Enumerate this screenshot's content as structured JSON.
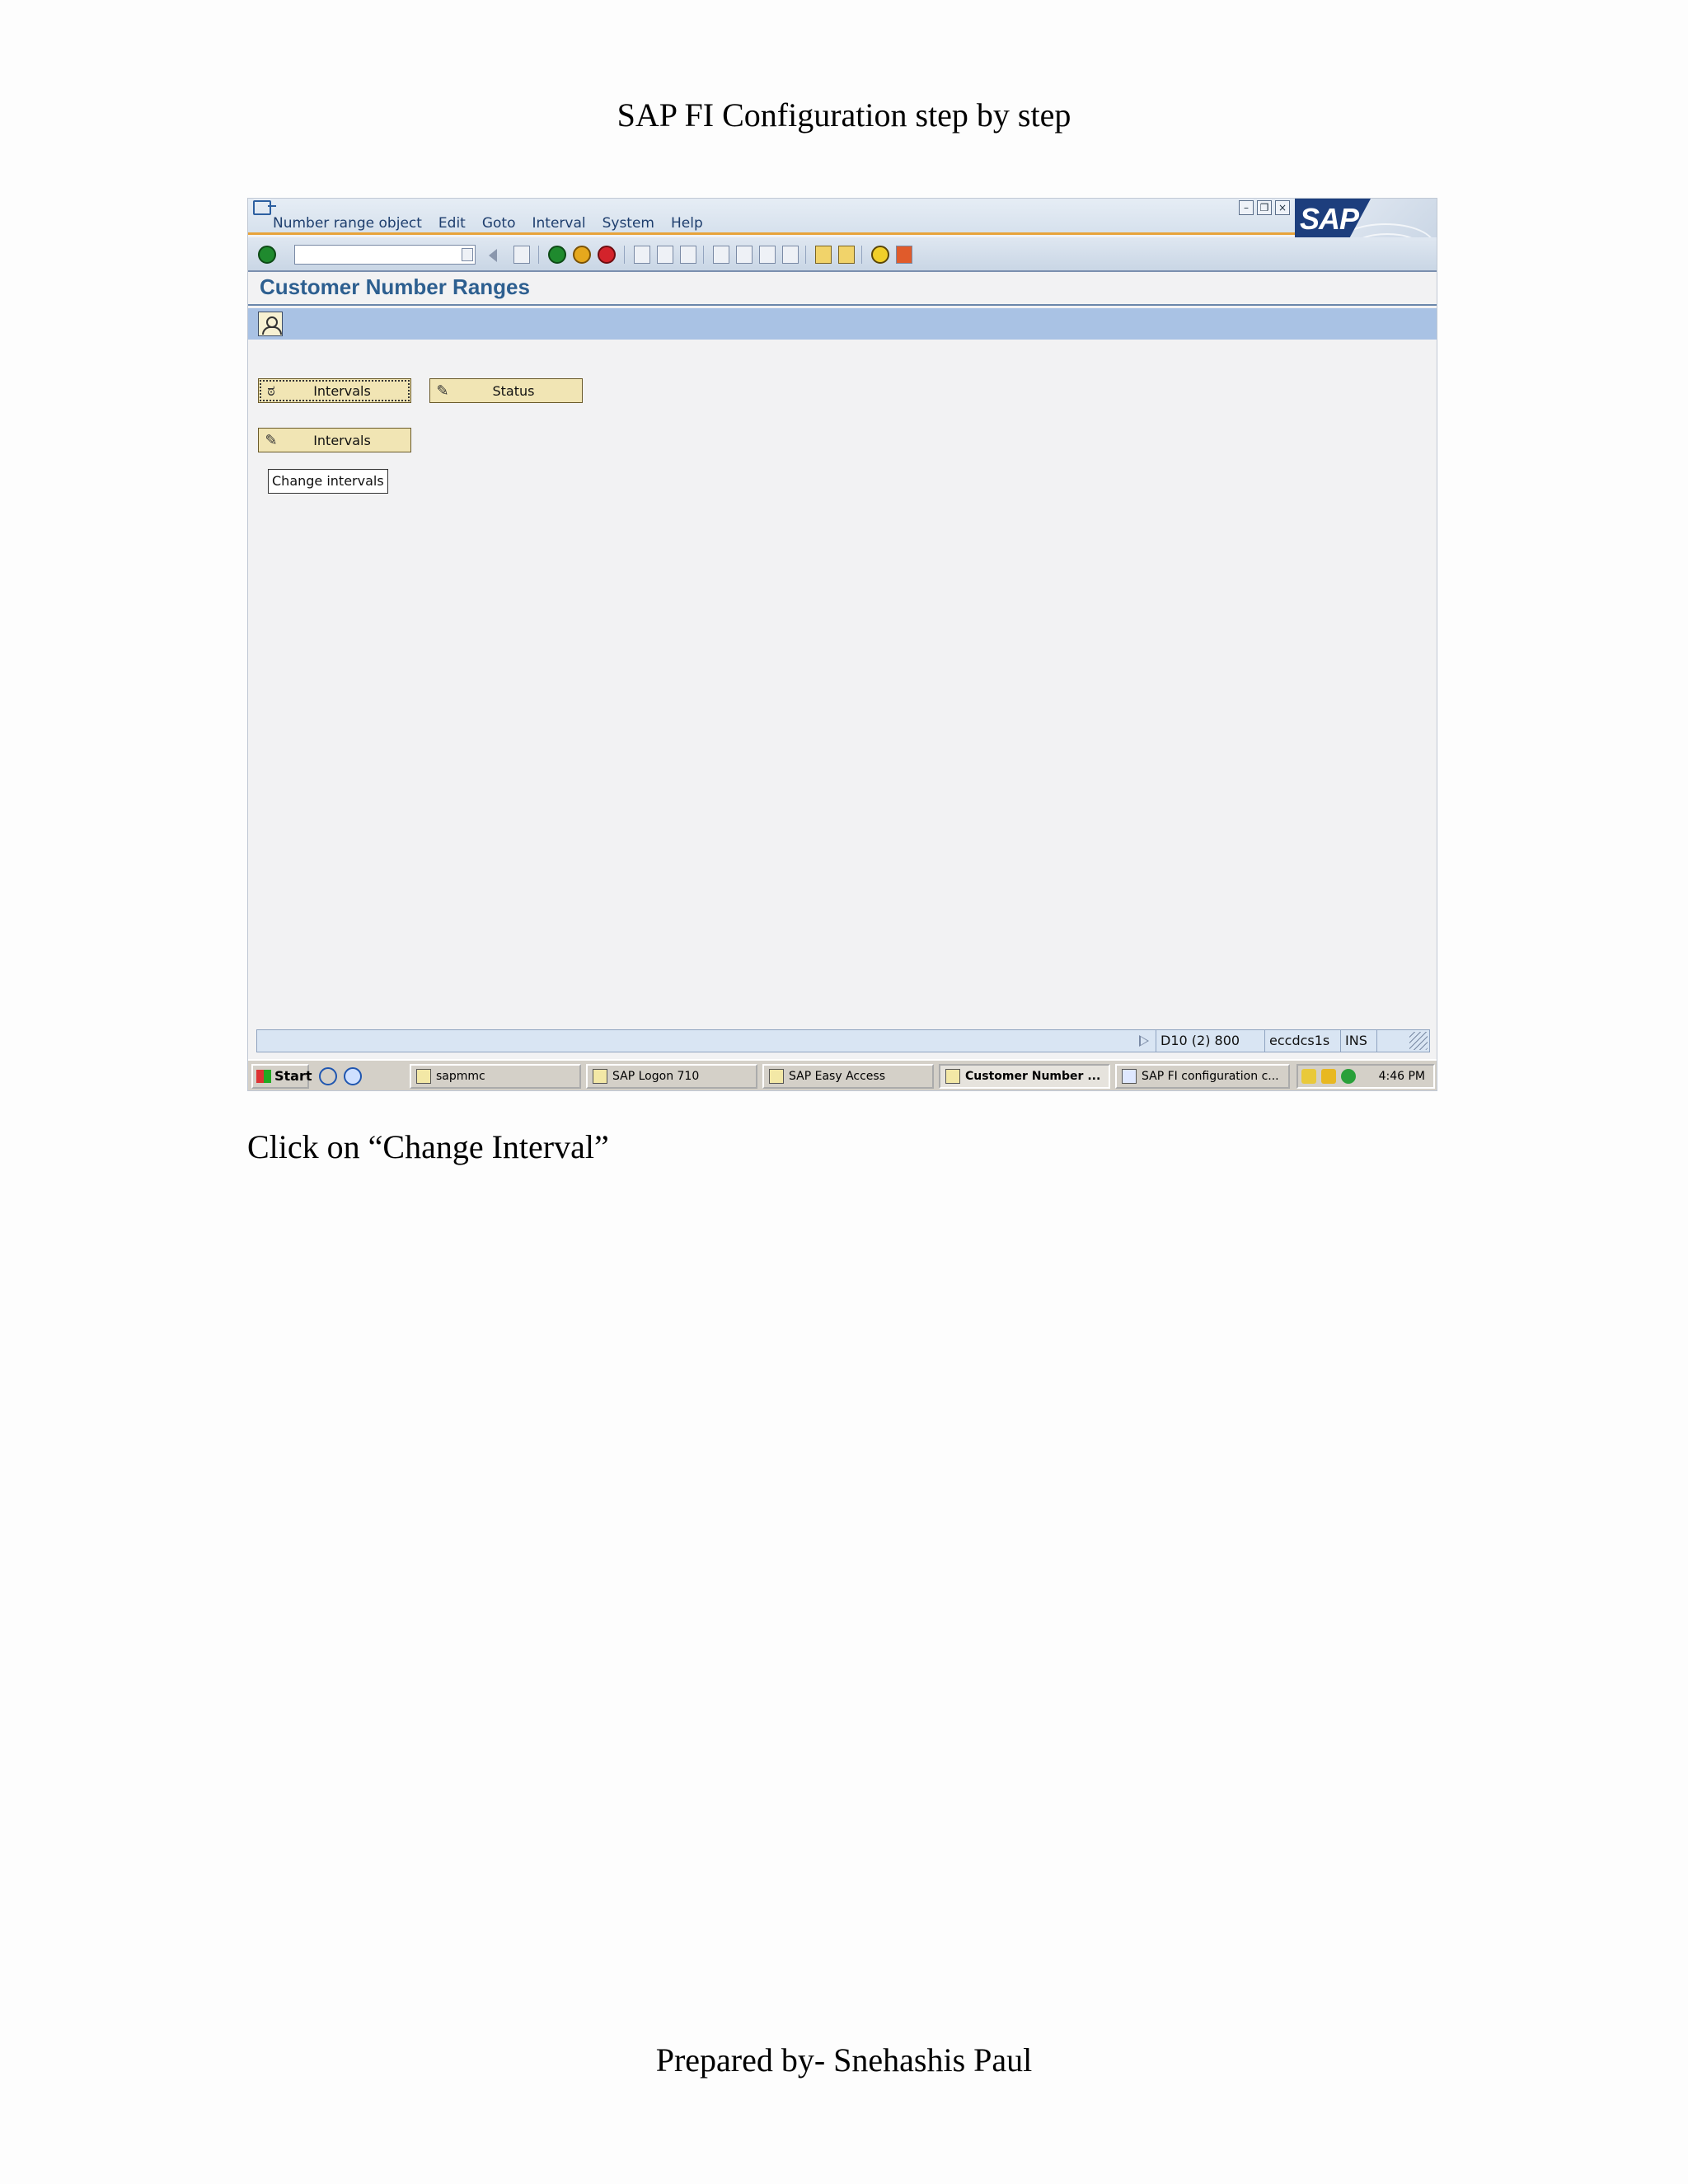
{
  "document": {
    "header": "SAP FI Configuration step by step",
    "caption": "Click on “Change Interval”",
    "footer": "Prepared by- Snehashis Paul"
  },
  "sap": {
    "menu": [
      "Number range object",
      "Edit",
      "Goto",
      "Interval",
      "System",
      "Help"
    ],
    "window_controls": [
      "minimize-icon",
      "restore-icon",
      "close-icon"
    ],
    "logo_text": "SAP",
    "command_field": {
      "value": ""
    },
    "title": "Customer Number Ranges",
    "buttons": {
      "intervals_display": "Intervals",
      "status": "Status",
      "intervals_change": "Intervals"
    },
    "tooltip": "Change intervals",
    "status_bar": {
      "system": "D10 (2) 800",
      "server": "eccdcs1s",
      "mode": "INS"
    }
  },
  "taskbar": {
    "start": "Start",
    "tasks": [
      {
        "label": "sapmmc",
        "active": false
      },
      {
        "label": "SAP Logon 710",
        "active": false
      },
      {
        "label": "SAP Easy Access",
        "active": false
      },
      {
        "label": "Customer Number ...",
        "active": true
      },
      {
        "label": "SAP FI configuration c...",
        "active": false
      }
    ],
    "clock": "4:46 PM"
  },
  "colors": {
    "sap_title": "#2d5f90",
    "app_toolbar": "#a9c2e4",
    "button_bg": "#f1e5b4",
    "menu_accent": "#e8a33a"
  }
}
